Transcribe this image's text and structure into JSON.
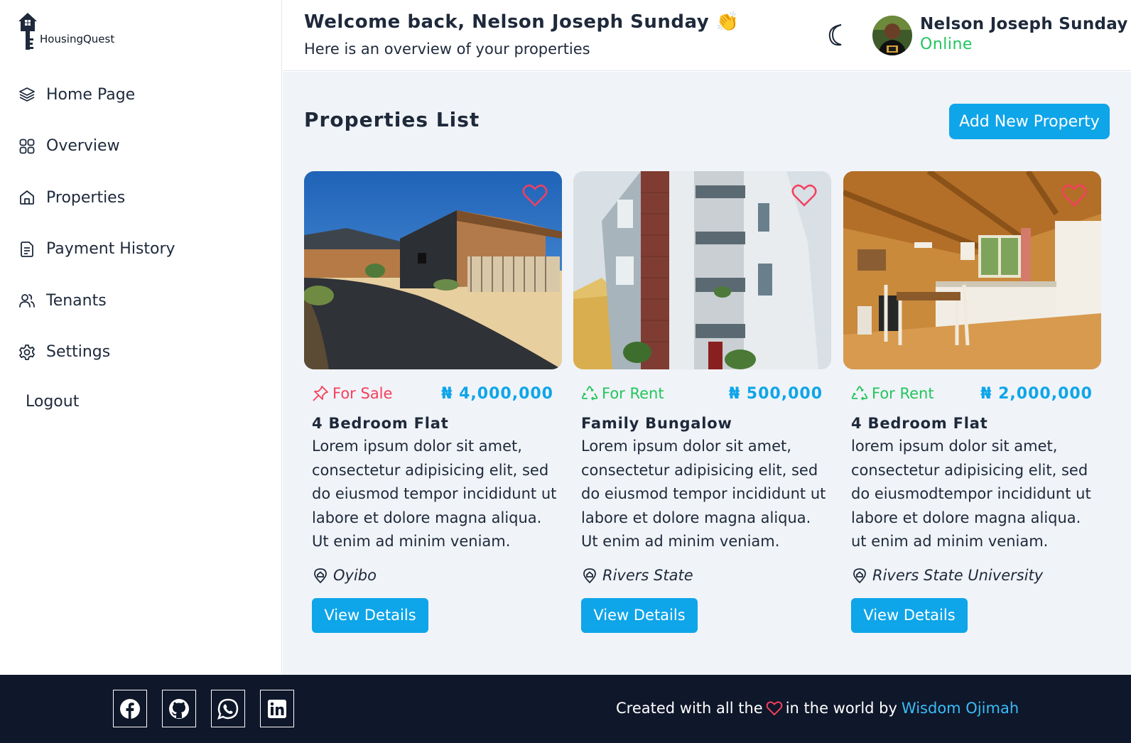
{
  "app": {
    "name": "HousingQuest"
  },
  "sidebar": {
    "items": [
      {
        "label": "Home Page",
        "icon": "layers-icon"
      },
      {
        "label": "Overview",
        "icon": "grid-icon"
      },
      {
        "label": "Properties",
        "icon": "home-icon"
      },
      {
        "label": "Payment History",
        "icon": "document-icon"
      },
      {
        "label": "Tenants",
        "icon": "users-icon"
      },
      {
        "label": "Settings",
        "icon": "gear-icon"
      }
    ],
    "logout_label": "Logout"
  },
  "header": {
    "welcome": "Welcome back, Nelson Joseph Sunday 👏",
    "subtitle": "Here is an overview of your properties",
    "user": {
      "name": "Nelson Joseph Sunday",
      "status": "Online"
    }
  },
  "main": {
    "title": "Properties List",
    "add_button_label": "Add New Property",
    "properties": [
      {
        "status": "For Sale",
        "status_icon": "pin-icon",
        "price": "₦ 4,000,000",
        "title": "4 Bedroom Flat",
        "description": "Lorem ipsum dolor sit amet, consectetur adipisicing elit, sed do eiusmod tempor incididunt ut labore et dolore magna aliqua. Ut enim ad minim veniam.",
        "location": "Oyibo",
        "button_label": "View Details"
      },
      {
        "status": "For Rent",
        "status_icon": "recycle-icon",
        "price": "₦ 500,000",
        "title": "Family Bungalow",
        "description": "Lorem ipsum dolor sit amet, consectetur adipisicing elit, sed do eiusmod tempor incididunt ut labore et dolore magna aliqua. Ut enim ad minim veniam.",
        "location": "Rivers State",
        "button_label": "View Details"
      },
      {
        "status": "For Rent",
        "status_icon": "recycle-icon",
        "price": "₦ 2,000,000",
        "title": "4 Bedroom Flat",
        "description": "lorem ipsum dolor sit amet, consectetur adipisicing elit, sed do eiusmodtempor incididunt ut labore et dolore magna aliqua. ut enim ad minim veniam.",
        "location": "Rivers State University",
        "button_label": "View Details"
      }
    ]
  },
  "footer": {
    "social": [
      "facebook-icon",
      "github-icon",
      "whatsapp-icon",
      "linkedin-icon"
    ],
    "credit_before": "Created with all the",
    "credit_after": "in the world by",
    "author": "Wisdom Ojimah"
  },
  "colors": {
    "accent": "#0ea5e9",
    "for_sale": "#f43f5e",
    "for_rent": "#22c55e",
    "online": "#22c55e",
    "footer_bg": "#0f172a",
    "main_bg": "#f0f3f7"
  }
}
